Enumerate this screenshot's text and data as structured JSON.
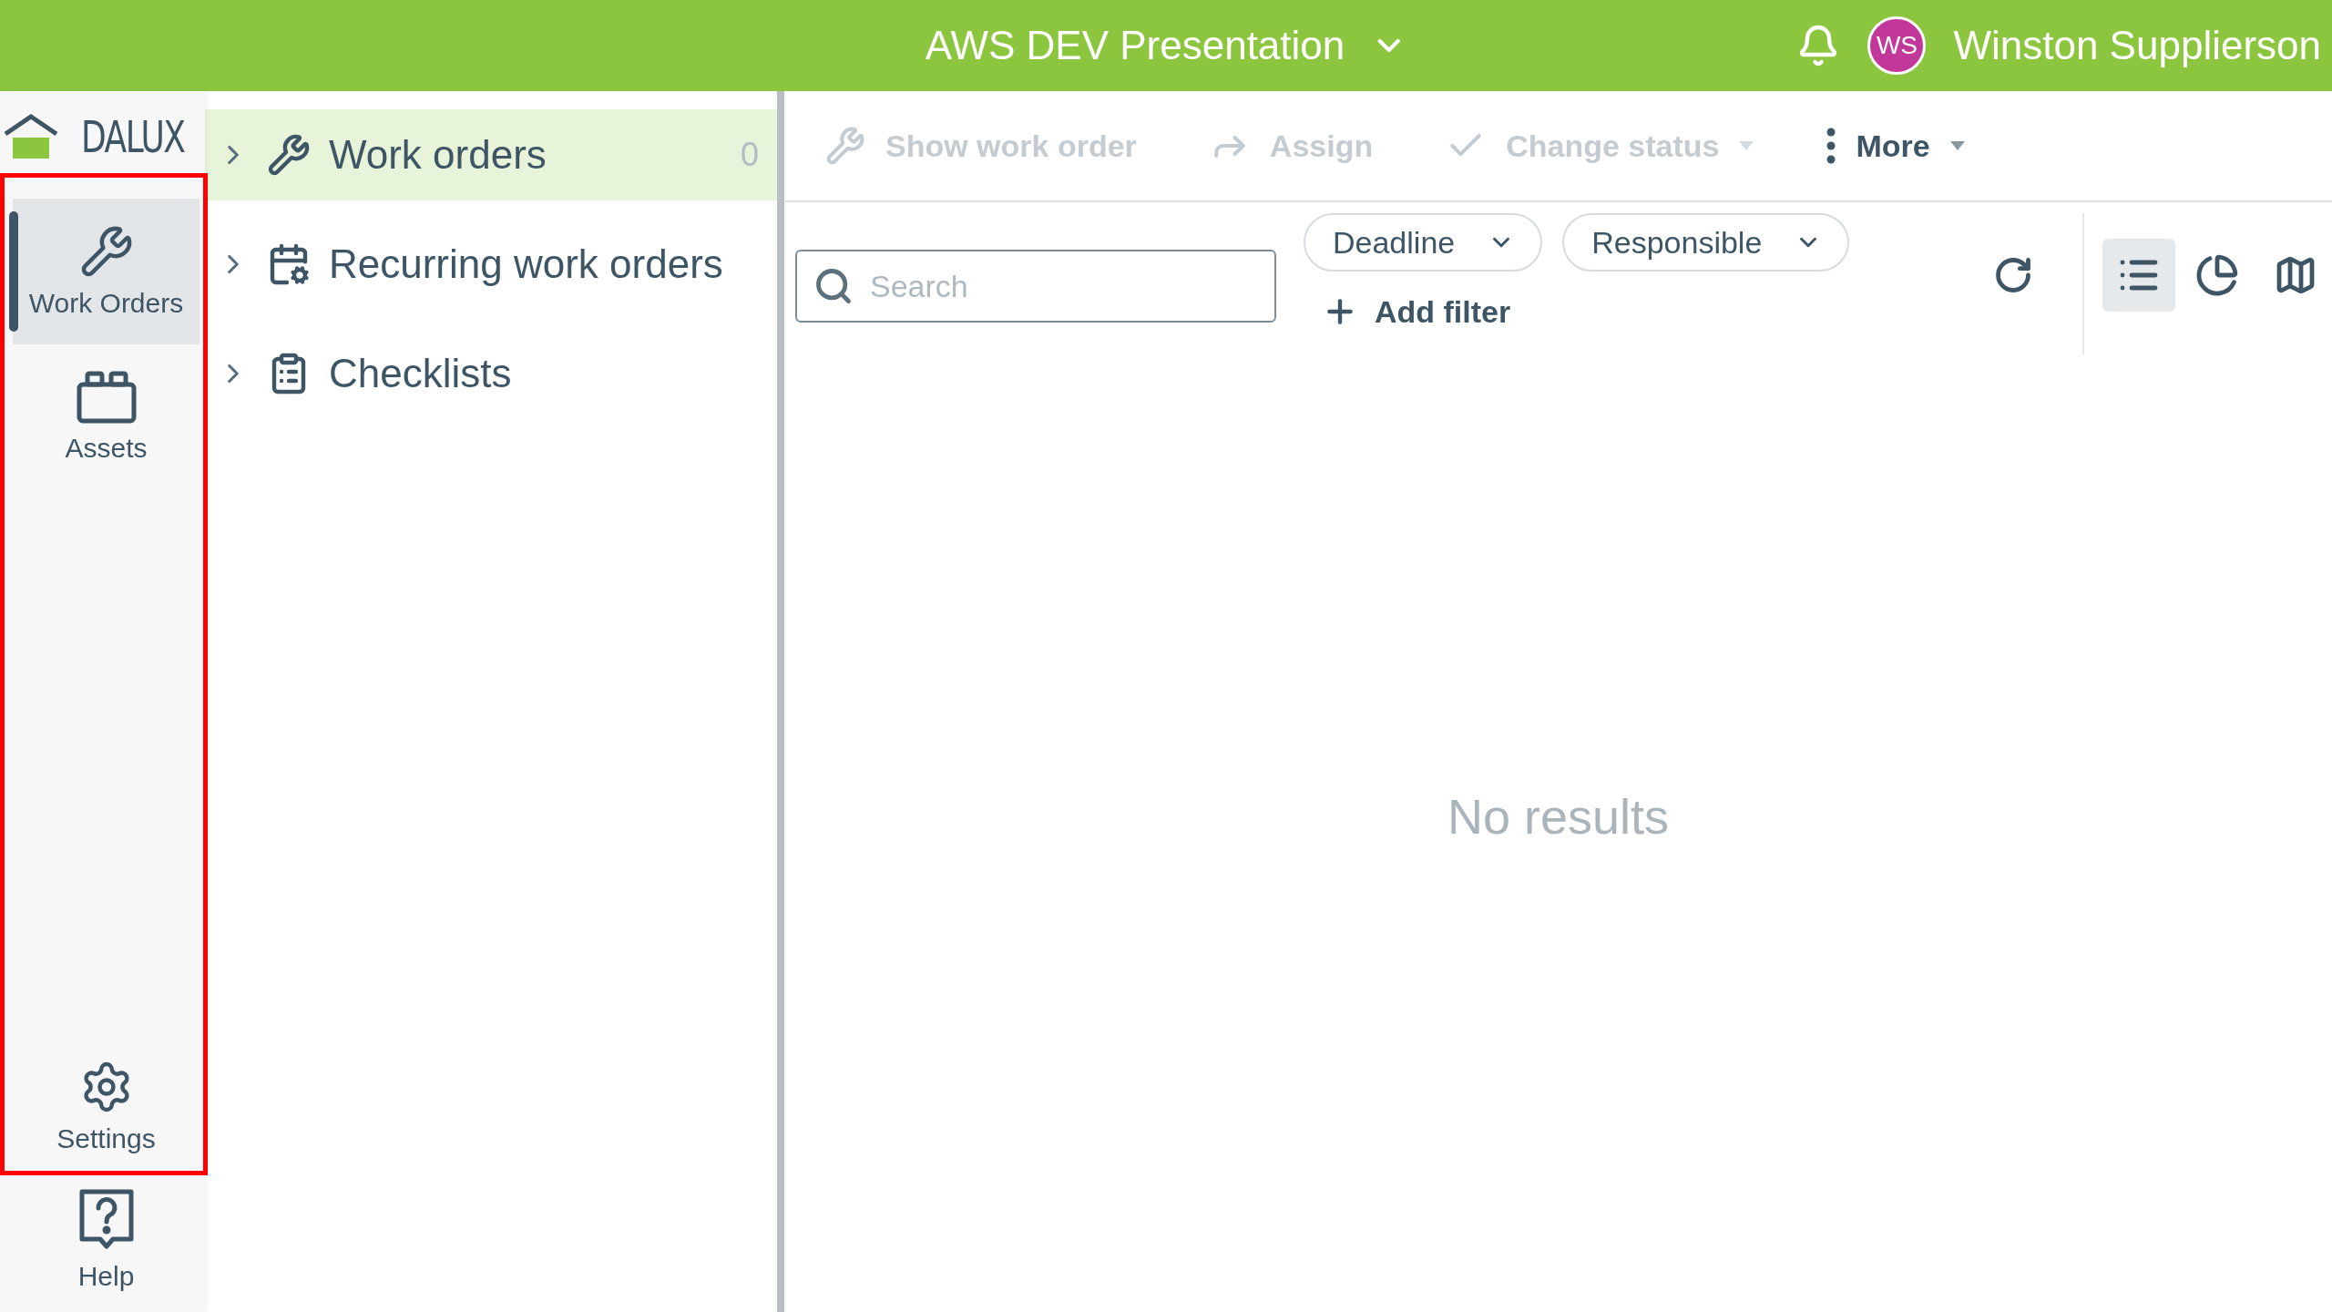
{
  "header": {
    "project": "AWS DEV Presentation",
    "user_initials": "WS",
    "user_name": "Winston Supplierson"
  },
  "logo": {
    "text": "DALUX"
  },
  "rail": [
    {
      "kind": "wrench",
      "label": "Work Orders",
      "selected": true
    },
    {
      "kind": "assets",
      "label": "Assets",
      "selected": false
    }
  ],
  "rail_bottom": [
    {
      "kind": "settings",
      "label": "Settings",
      "selected": false
    },
    {
      "kind": "help",
      "label": "Help",
      "selected": false
    }
  ],
  "nav": [
    {
      "label": "Work orders",
      "count": "0",
      "selected": true
    },
    {
      "label": "Recurring work orders",
      "selected": false
    },
    {
      "label": "Checklists",
      "selected": false
    }
  ],
  "toolbar": [
    {
      "label": "Show work order",
      "disabled": true,
      "dropdown": false
    },
    {
      "label": "Assign",
      "disabled": true,
      "dropdown": false
    },
    {
      "label": "Change status",
      "disabled": true,
      "dropdown": true
    },
    {
      "label": "More",
      "disabled": false,
      "dropdown": true
    }
  ],
  "search": {
    "placeholder": "Search"
  },
  "filters": [
    "Deadline",
    "Responsible"
  ],
  "add_filter": "Add filter",
  "views": [
    {
      "kind": "list",
      "selected": true
    },
    {
      "kind": "chart",
      "selected": false
    },
    {
      "kind": "map",
      "selected": false
    }
  ],
  "empty_message": "No results"
}
